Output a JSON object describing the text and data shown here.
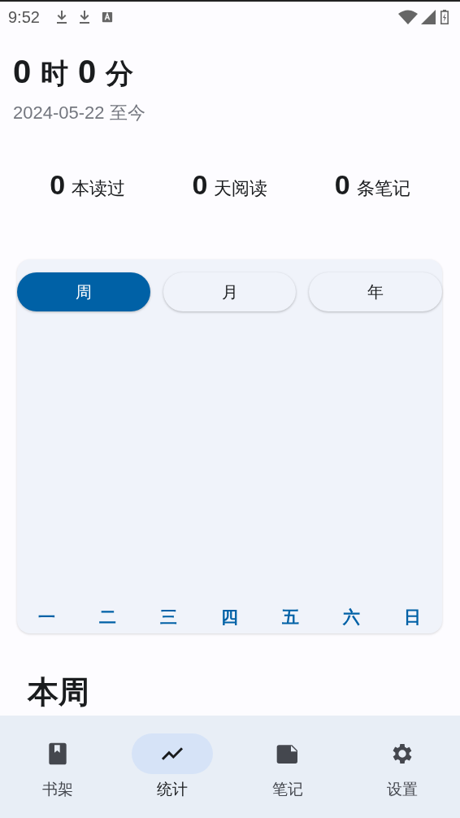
{
  "status_bar": {
    "time": "9:52"
  },
  "summary": {
    "hours": "0",
    "hours_unit": "时",
    "minutes": "0",
    "minutes_unit": "分",
    "since": "2024-05-22 至今"
  },
  "stats": [
    {
      "value": "0",
      "label": "本读过"
    },
    {
      "value": "0",
      "label": "天阅读"
    },
    {
      "value": "0",
      "label": "条笔记"
    }
  ],
  "period_tabs": [
    {
      "label": "周",
      "selected": true
    },
    {
      "label": "月",
      "selected": false
    },
    {
      "label": "年",
      "selected": false
    }
  ],
  "chart_days": [
    "一",
    "二",
    "三",
    "四",
    "五",
    "六",
    "日"
  ],
  "section_heading": "本周",
  "bottom_nav": [
    {
      "label": "书架",
      "kind": "book",
      "selected": false
    },
    {
      "label": "统计",
      "kind": "chart",
      "selected": true
    },
    {
      "label": "笔记",
      "kind": "note",
      "selected": false
    },
    {
      "label": "设置",
      "kind": "gear",
      "selected": false
    }
  ]
}
